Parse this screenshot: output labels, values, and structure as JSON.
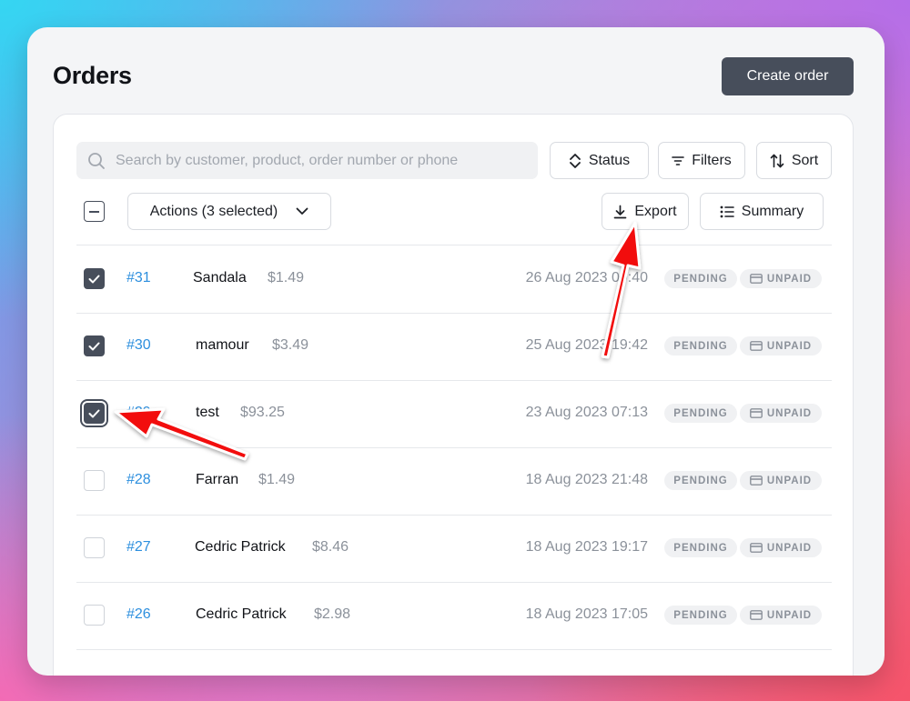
{
  "header": {
    "title": "Orders",
    "create_label": "Create order"
  },
  "toolbar": {
    "search_placeholder": "Search by customer, product, order number or phone",
    "status_label": "Status",
    "filters_label": "Filters",
    "sort_label": "Sort",
    "actions_label": "Actions (3 selected)",
    "export_label": "Export",
    "summary_label": "Summary"
  },
  "orders": [
    {
      "number": "#31",
      "customer": "Sandala",
      "amount": "$1.49",
      "date": "26 Aug 2023 09:40",
      "status": "PENDING",
      "payment": "UNPAID",
      "checked": true
    },
    {
      "number": "#30",
      "customer": "mamour",
      "amount": "$3.49",
      "date": "25 Aug 2023 19:42",
      "status": "PENDING",
      "payment": "UNPAID",
      "checked": true
    },
    {
      "number": "#29",
      "customer": "test",
      "amount": "$93.25",
      "date": "23 Aug 2023 07:13",
      "status": "PENDING",
      "payment": "UNPAID",
      "checked": true
    },
    {
      "number": "#28",
      "customer": "Farran",
      "amount": "$1.49",
      "date": "18 Aug 2023 21:48",
      "status": "PENDING",
      "payment": "UNPAID",
      "checked": false
    },
    {
      "number": "#27",
      "customer": "Cedric Patrick",
      "amount": "$8.46",
      "date": "18 Aug 2023 19:17",
      "status": "PENDING",
      "payment": "UNPAID",
      "checked": false
    },
    {
      "number": "#26",
      "customer": "Cedric Patrick",
      "amount": "$2.98",
      "date": "18 Aug 2023 17:05",
      "status": "PENDING",
      "payment": "UNPAID",
      "checked": false
    }
  ],
  "colors": {
    "accent": "#474e5b",
    "link": "#2d8fde",
    "annotation": "#f20d0d"
  }
}
